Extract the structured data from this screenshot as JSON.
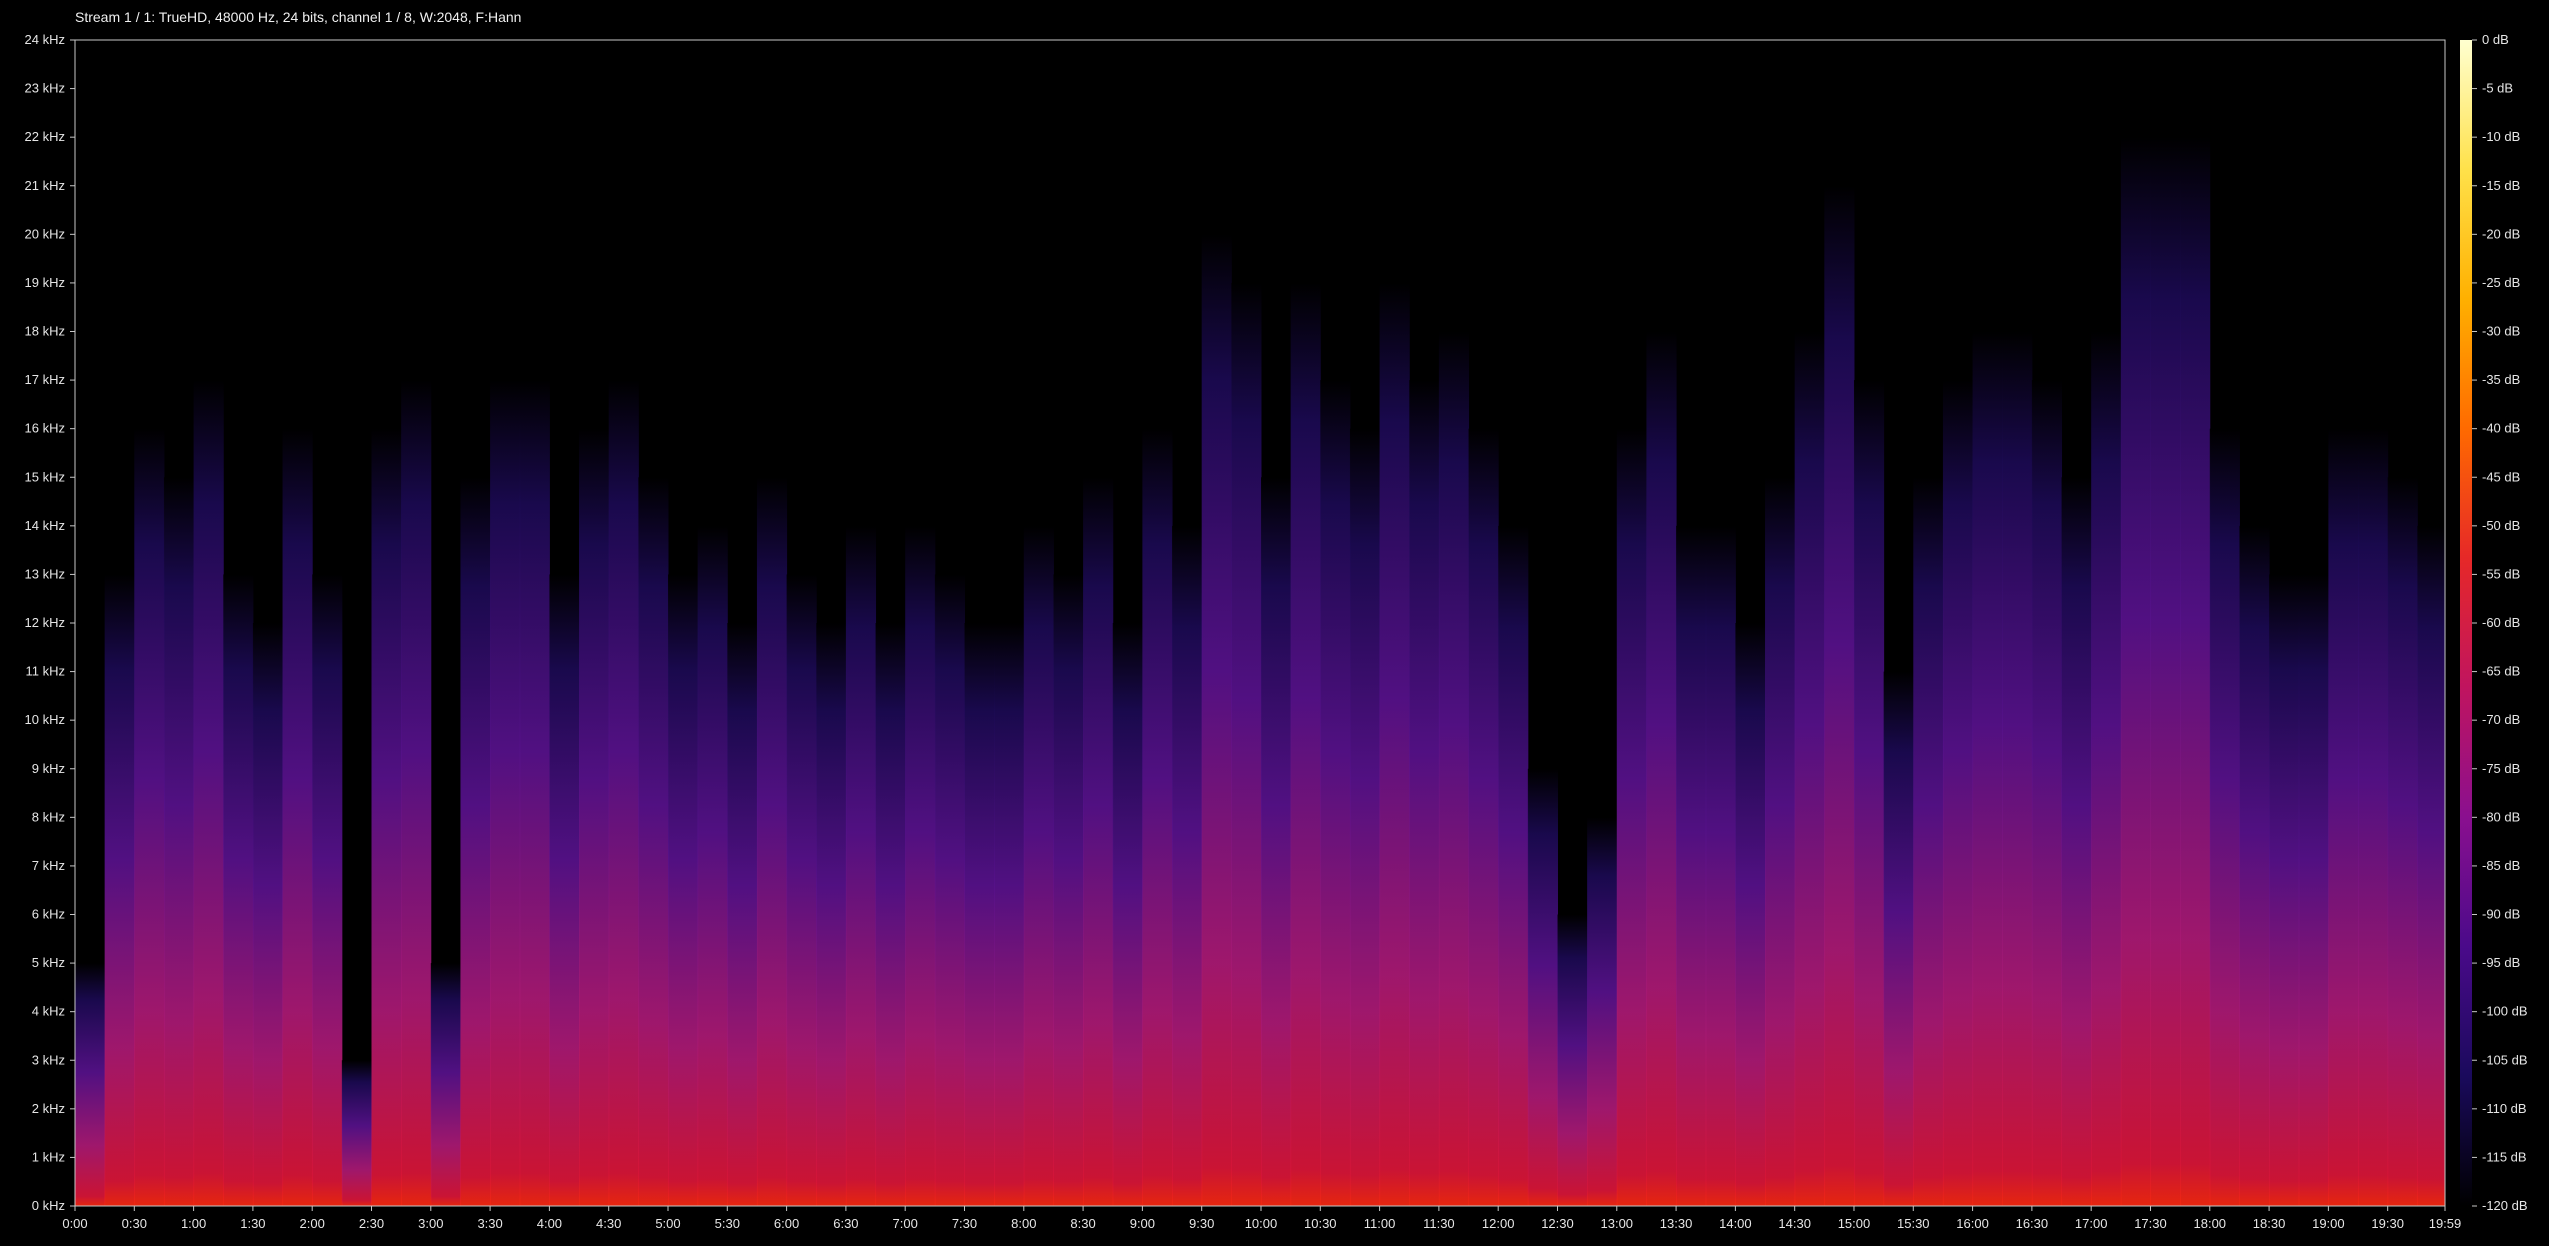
{
  "title": "Stream 1 / 1: TrueHD, 48000 Hz, 24 bits, channel 1 / 8, W:2048, F:Hann",
  "chart_data": {
    "type": "heatmap",
    "subtype": "spectrogram",
    "title": "Stream 1 / 1: TrueHD, 48000 Hz, 24 bits, channel 1 / 8, W:2048, F:Hann",
    "x_unit": "time (m:ss)",
    "y_unit": "kHz",
    "xlim_seconds": [
      0,
      1199
    ],
    "ylim_khz": [
      0,
      24
    ],
    "x_tick_labels": [
      "0:00",
      "0:30",
      "1:00",
      "1:30",
      "2:00",
      "2:30",
      "3:00",
      "3:30",
      "4:00",
      "4:30",
      "5:00",
      "5:30",
      "6:00",
      "6:30",
      "7:00",
      "7:30",
      "8:00",
      "8:30",
      "9:00",
      "9:30",
      "10:00",
      "10:30",
      "11:00",
      "11:30",
      "12:00",
      "12:30",
      "13:00",
      "13:30",
      "14:00",
      "14:30",
      "15:00",
      "15:30",
      "16:00",
      "16:30",
      "17:00",
      "17:30",
      "18:00",
      "18:30",
      "19:00",
      "19:30",
      "19:59"
    ],
    "y_tick_labels": [
      "0 kHz",
      "1 kHz",
      "2 kHz",
      "3 kHz",
      "4 kHz",
      "5 kHz",
      "6 kHz",
      "7 kHz",
      "8 kHz",
      "9 kHz",
      "10 kHz",
      "11 kHz",
      "12 kHz",
      "13 kHz",
      "14 kHz",
      "15 kHz",
      "16 kHz",
      "17 kHz",
      "18 kHz",
      "19 kHz",
      "20 kHz",
      "21 kHz",
      "22 kHz",
      "23 kHz",
      "24 kHz"
    ],
    "colorbar": {
      "range_db": [
        -120,
        0
      ],
      "tick_labels": [
        "0 dB",
        "-5 dB",
        "-10 dB",
        "-15 dB",
        "-20 dB",
        "-25 dB",
        "-30 dB",
        "-35 dB",
        "-40 dB",
        "-45 dB",
        "-50 dB",
        "-55 dB",
        "-60 dB",
        "-65 dB",
        "-70 dB",
        "-75 dB",
        "-80 dB",
        "-85 dB",
        "-90 dB",
        "-95 dB",
        "-100 dB",
        "-105 dB",
        "-110 dB",
        "-115 dB",
        "-120 dB"
      ],
      "colors": [
        "#000000",
        "#1a0a5c",
        "#4a0a8a",
        "#8a0f8f",
        "#c0145f",
        "#e62828",
        "#ff6a00",
        "#ffb000",
        "#ffe14a",
        "#ffffd0"
      ]
    },
    "colors": {
      "background": "#000000",
      "axis": "#c8c8c8",
      "text": "#e6e6e6"
    },
    "segments_energy": {
      "description_unit": "approximate upper frequency extent (kHz) per time segment",
      "time_seconds": [
        0,
        15,
        30,
        45,
        60,
        75,
        90,
        105,
        120,
        135,
        150,
        165,
        180,
        195,
        210,
        225,
        240,
        255,
        270,
        285,
        300,
        315,
        330,
        345,
        360,
        375,
        390,
        405,
        420,
        435,
        450,
        465,
        480,
        495,
        510,
        525,
        540,
        555,
        570,
        585,
        600,
        615,
        630,
        645,
        660,
        675,
        690,
        705,
        720,
        735,
        750,
        765,
        780,
        795,
        810,
        825,
        840,
        855,
        870,
        885,
        900,
        915,
        930,
        945,
        960,
        975,
        990,
        1005,
        1020,
        1035,
        1050,
        1065,
        1080,
        1095,
        1110,
        1125,
        1140,
        1155,
        1170,
        1185
      ],
      "upper_khz": [
        5,
        13,
        16,
        15,
        17,
        13,
        12,
        16,
        13,
        3,
        16,
        17,
        5,
        15,
        17,
        17,
        13,
        16,
        17,
        15,
        13,
        14,
        12,
        15,
        13,
        12,
        14,
        12,
        14,
        13,
        12,
        12,
        14,
        13,
        15,
        12,
        16,
        14,
        20,
        19,
        15,
        19,
        17,
        16,
        19,
        17,
        18,
        16,
        14,
        9,
        6,
        8,
        16,
        18,
        14,
        14,
        12,
        15,
        18,
        21,
        17,
        11,
        15,
        17,
        18,
        18,
        17,
        15,
        18,
        22,
        22,
        22,
        16,
        14,
        13,
        13,
        16,
        16,
        15,
        14
      ]
    }
  }
}
